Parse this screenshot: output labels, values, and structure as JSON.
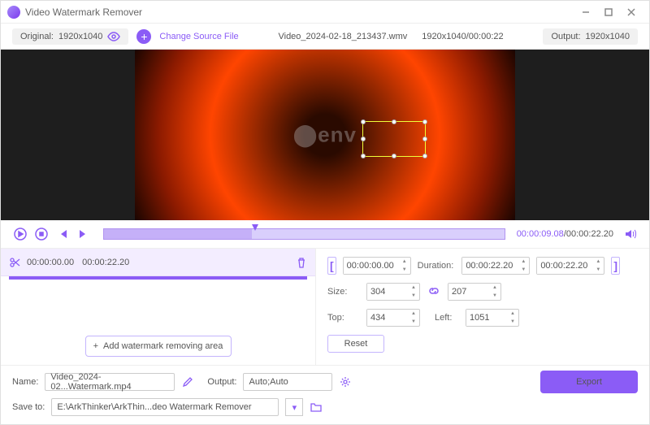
{
  "title_bar": {
    "app_name": "Video Watermark Remover"
  },
  "top": {
    "original_label": "Original:",
    "original_res": "1920x1040",
    "change_source": "Change Source File",
    "file_name": "Video_2024-02-18_213437.wmv",
    "file_meta": "1920x1040/00:00:22",
    "output_label": "Output:",
    "output_res": "1920x1040"
  },
  "preview": {
    "watermark_text": "⬤env"
  },
  "playback": {
    "current": "00:00:09.08",
    "total": "00:00:22.20"
  },
  "segment": {
    "start": "00:00:00.00",
    "end": "00:00:22.20"
  },
  "range": {
    "start": "00:00:00.00",
    "dur_label": "Duration:",
    "duration": "00:00:22.20",
    "end": "00:00:22.20"
  },
  "size": {
    "label": "Size:",
    "w": "304",
    "h": "207"
  },
  "pos": {
    "top_label": "Top:",
    "top": "434",
    "left_label": "Left:",
    "left": "1051"
  },
  "buttons": {
    "add_area": "Add watermark removing area",
    "reset": "Reset",
    "export": "Export"
  },
  "bottom": {
    "name_label": "Name:",
    "name_value": "Video_2024-02...Watermark.mp4",
    "output_label": "Output:",
    "output_value": "Auto;Auto",
    "save_label": "Save to:",
    "save_value": "E:\\ArkThinker\\ArkThin...deo Watermark Remover"
  }
}
